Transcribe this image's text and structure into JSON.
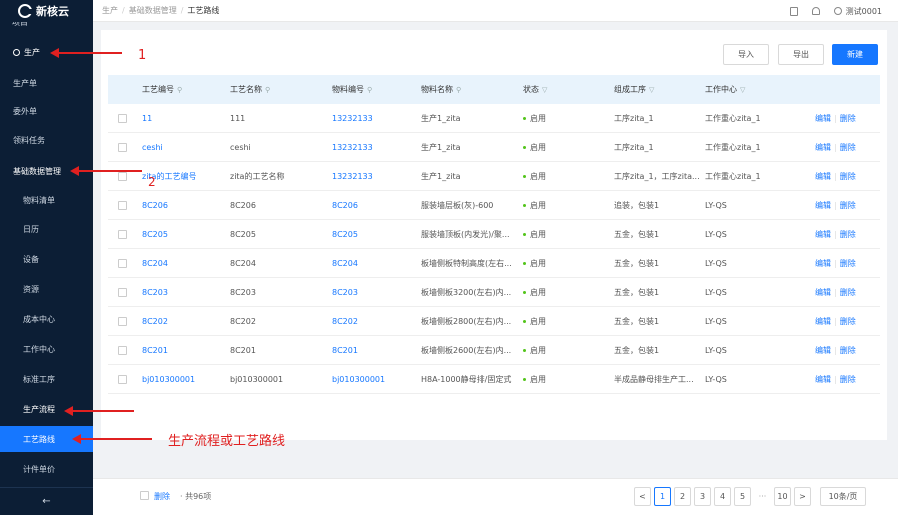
{
  "app": {
    "logo_text": "新核云"
  },
  "header": {
    "breadcrumb": [
      "生产",
      "基础数据管理",
      "工艺路线"
    ],
    "user": "测试0001"
  },
  "sidebar": {
    "clipped_top": "项目",
    "production": "生产",
    "items": [
      {
        "label": "生产单"
      },
      {
        "label": "委外单"
      },
      {
        "label": "领料任务"
      },
      {
        "label": "基础数据管理"
      },
      {
        "label": "物料清单"
      },
      {
        "label": "日历"
      },
      {
        "label": "设备"
      },
      {
        "label": "资源"
      },
      {
        "label": "成本中心"
      },
      {
        "label": "工作中心"
      },
      {
        "label": "标准工序"
      },
      {
        "label": "生产流程"
      },
      {
        "label": "工艺路线"
      },
      {
        "label": "计件单价"
      }
    ],
    "collapse": "←"
  },
  "toolbar": {
    "import": "导入",
    "export": "导出",
    "new": "新建"
  },
  "table": {
    "columns": [
      "工艺编号",
      "工艺名称",
      "物料编号",
      "物料名称",
      "状态",
      "组成工序",
      "工作中心"
    ],
    "actions": {
      "edit": "编辑",
      "delete": "删除"
    },
    "rows": [
      {
        "code": "11",
        "name": "111",
        "mat_code": "13232133",
        "mat_name": "生产1_zita",
        "status": "启用",
        "proc": "工序zita_1",
        "center": "工作重心zita_1"
      },
      {
        "code": "ceshi",
        "name": "ceshi",
        "mat_code": "13232133",
        "mat_name": "生产1_zita",
        "status": "启用",
        "proc": "工序zita_1",
        "center": "工作重心zita_1"
      },
      {
        "code": "zita的工艺编号",
        "name": "zita的工艺名称",
        "mat_code": "13232133",
        "mat_name": "生产1_zita",
        "status": "启用",
        "proc": "工序zita_1，工序zita...",
        "center": "工作重心zita_1"
      },
      {
        "code": "8C206",
        "name": "8C206",
        "mat_code": "8C206",
        "mat_name": "服装墙层板(灰)-600",
        "status": "启用",
        "proc": "追装，包装1",
        "center": "LY-QS"
      },
      {
        "code": "8C205",
        "name": "8C205",
        "mat_code": "8C205",
        "mat_name": "服装墙顶板(内发光)/聚...",
        "status": "启用",
        "proc": "五金，包装1",
        "center": "LY-QS"
      },
      {
        "code": "8C204",
        "name": "8C204",
        "mat_code": "8C204",
        "mat_name": "板墙侧板特制高度(左右...",
        "status": "启用",
        "proc": "五金，包装1",
        "center": "LY-QS"
      },
      {
        "code": "8C203",
        "name": "8C203",
        "mat_code": "8C203",
        "mat_name": "板墙侧板3200(左右)内...",
        "status": "启用",
        "proc": "五金，包装1",
        "center": "LY-QS"
      },
      {
        "code": "8C202",
        "name": "8C202",
        "mat_code": "8C202",
        "mat_name": "板墙侧板2800(左右)内...",
        "status": "启用",
        "proc": "五金，包装1",
        "center": "LY-QS"
      },
      {
        "code": "8C201",
        "name": "8C201",
        "mat_code": "8C201",
        "mat_name": "板墙侧板2600(左右)内...",
        "status": "启用",
        "proc": "五金，包装1",
        "center": "LY-QS"
      },
      {
        "code": "bj010300001",
        "name": "bj010300001",
        "mat_code": "bj010300001",
        "mat_name": "H8A-1000静母排/固定式",
        "status": "启用",
        "proc": "半成品静母排生产工...",
        "center": "LY-QS"
      }
    ]
  },
  "footer": {
    "delete": "删除",
    "total": "· 共96项",
    "pages": [
      "1",
      "2",
      "3",
      "4",
      "5",
      "···",
      "10"
    ],
    "prev": "<",
    "next": ">",
    "page_size": "10条/页"
  },
  "annotations": {
    "label_1": "1",
    "label_2": "2",
    "label_3": "生产流程或工艺路线",
    "color": "#e02020"
  }
}
